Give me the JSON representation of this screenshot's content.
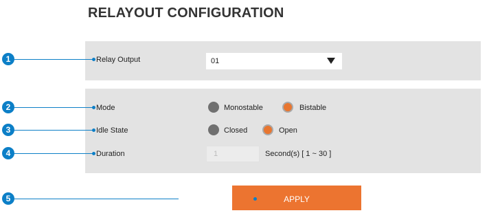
{
  "page": {
    "title": "RELAYOUT CONFIGURATION"
  },
  "callouts": [
    "1",
    "2",
    "3",
    "4",
    "5"
  ],
  "relay_output": {
    "label": "Relay Output",
    "selected": "01"
  },
  "mode": {
    "label": "Mode",
    "options": [
      "Monostable",
      "Bistable"
    ],
    "selected": "Bistable"
  },
  "idle_state": {
    "label": "Idle State",
    "options": [
      "Closed",
      "Open"
    ],
    "selected": "Open"
  },
  "duration": {
    "label": "Duration",
    "value": "1",
    "unit": "Second(s) [ 1 ~ 30 ]"
  },
  "apply": {
    "label": "APPLY"
  },
  "colors": {
    "accent": "#ec7430",
    "callout": "#0c7fc7",
    "panel": "#e3e3e3"
  }
}
